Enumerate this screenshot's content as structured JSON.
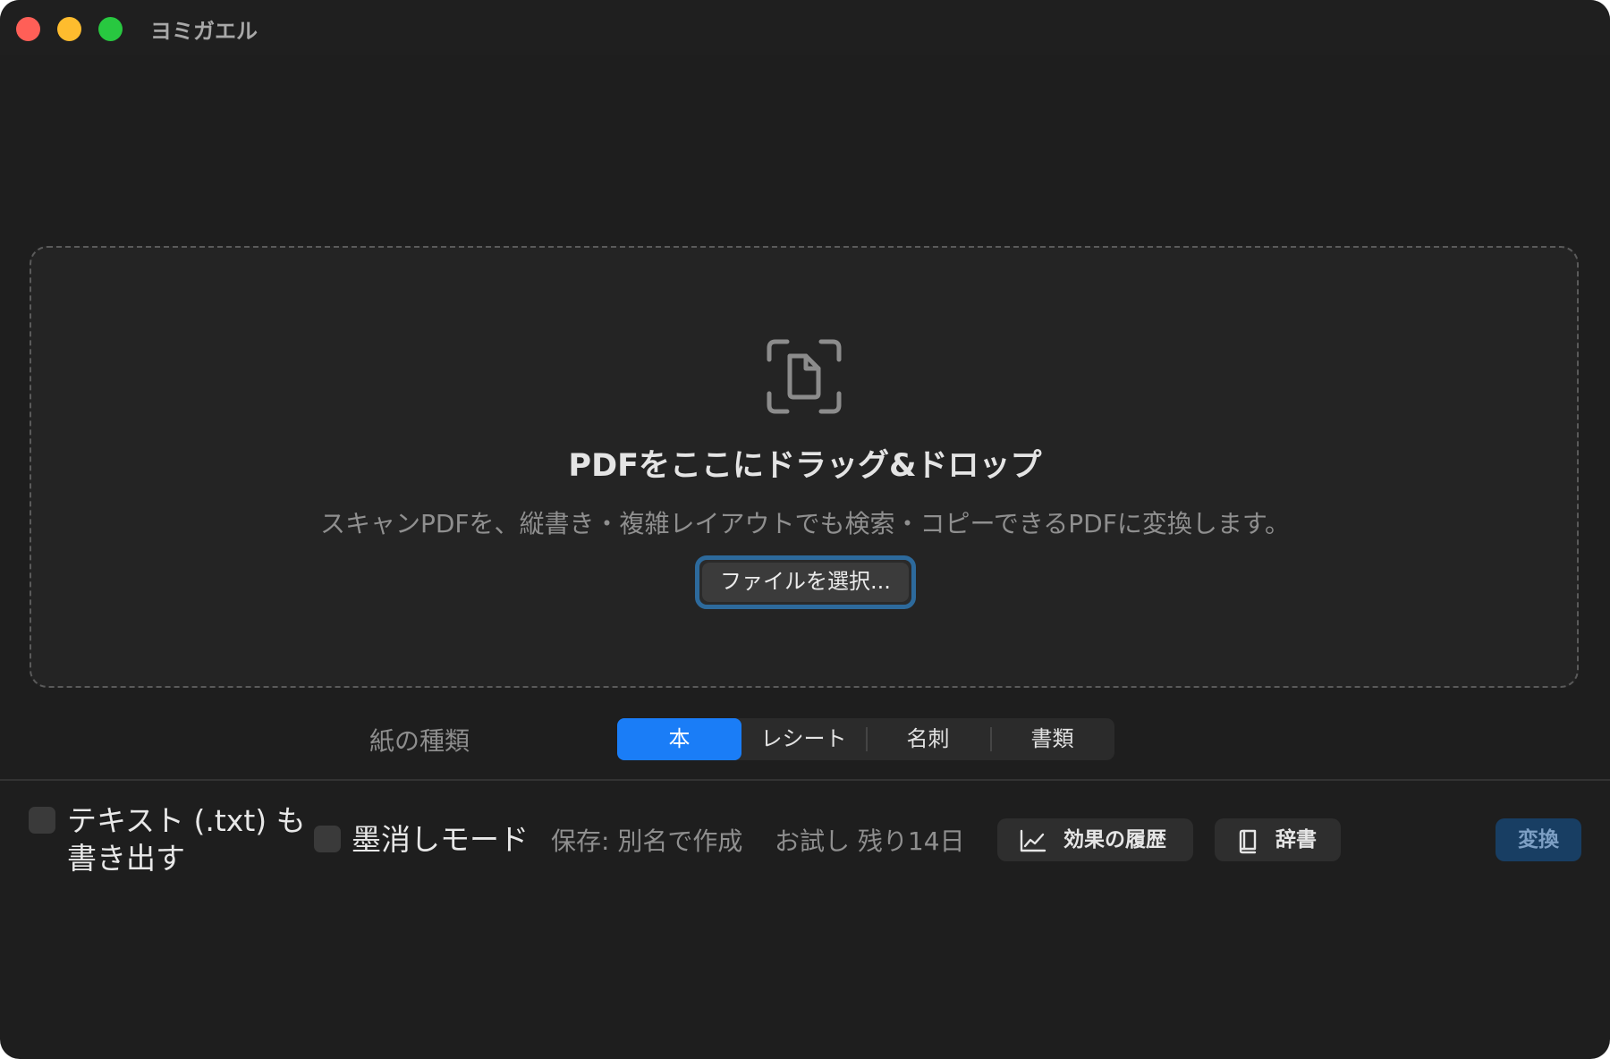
{
  "window": {
    "title": "ヨミガエル"
  },
  "dropzone": {
    "icon": "document-scan-icon",
    "heading": "PDFをここにドラッグ&ドロップ",
    "subtitle": "スキャンPDFを、縦書き・複雑レイアウトでも検索・コピーできるPDFに変換します。",
    "select_button": "ファイルを選択..."
  },
  "paper_type": {
    "label": "紙の種類",
    "options": [
      {
        "label": "本",
        "selected": true
      },
      {
        "label": "レシート",
        "selected": false
      },
      {
        "label": "名刺",
        "selected": false
      },
      {
        "label": "書類",
        "selected": false
      }
    ]
  },
  "options": {
    "export_text": {
      "line1": "テキスト (.txt) も",
      "line2": "書き出す",
      "checked": false
    },
    "redaction": {
      "label": "墨消しモード",
      "checked": false
    }
  },
  "status": {
    "save": "保存: 別名で作成",
    "trial": "お試し 残り14日"
  },
  "actions": {
    "history": {
      "label": "効果の履歴",
      "icon": "chart-line-icon"
    },
    "dictionary": {
      "label": "辞書",
      "icon": "book-icon"
    },
    "convert": "変換"
  },
  "colors": {
    "window_bg": "#1e1e1e",
    "accent": "#1a7df7",
    "focus_ring": "#2d6a9c",
    "convert_bg": "#183e63"
  }
}
